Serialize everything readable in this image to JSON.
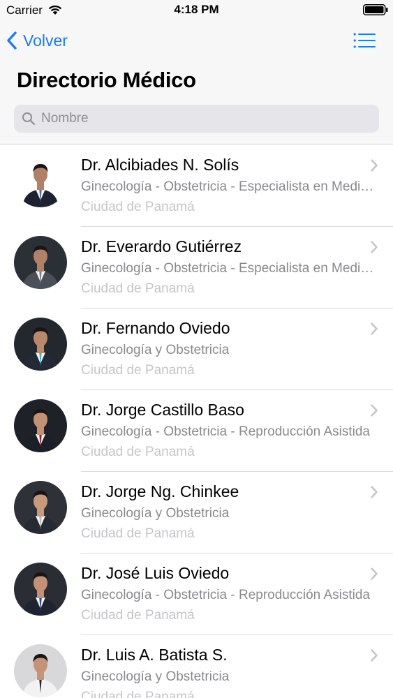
{
  "status_bar": {
    "carrier": "Carrier",
    "time": "4:18 PM",
    "icons": [
      "wifi-icon",
      "battery-icon"
    ]
  },
  "nav": {
    "back_label": "Volver",
    "back_icon": "chevron-left-icon",
    "menu_icon": "list-icon",
    "accent_color": "#1a7cf6"
  },
  "page": {
    "title": "Directorio Médico"
  },
  "search": {
    "placeholder": "Nombre",
    "value": "",
    "icon": "search-icon"
  },
  "doctors": [
    {
      "name": "Dr. Alcibiades N. Solís",
      "specialty": "Ginecología - Obstetricia - Especialista en Medicina Materno Fetal",
      "city": "Ciudad de Panamá",
      "photo_bg": "#ffffff",
      "suit": "#1d2230",
      "tie": "#5a6c94",
      "skin": "#b08068"
    },
    {
      "name": "Dr. Everardo Gutiérrez",
      "specialty": "Ginecología - Obstetricia - Especialista en Medicina Materno Fetal",
      "city": "Ciudad de Panamá",
      "photo_bg": "#2b2f36",
      "suit": "#4b5058",
      "tie": "#7a8090",
      "skin": "#b08068"
    },
    {
      "name": "Dr. Fernando Oviedo",
      "specialty": "Ginecología y Obstetricia",
      "city": "Ciudad de Panamá",
      "photo_bg": "#23272e",
      "suit": "#232a36",
      "tie": "#3cb8c0",
      "skin": "#b9896e"
    },
    {
      "name": "Dr. Jorge Castillo Baso",
      "specialty": "Ginecología - Obstetricia - Reproducción Asistida",
      "city": "Ciudad de Panamá",
      "photo_bg": "#1e2128",
      "suit": "#1b1f28",
      "tie": "#8b2030",
      "skin": "#c39276"
    },
    {
      "name": "Dr. Jorge Ng. Chinkee",
      "specialty": "Ginecología y Obstetricia",
      "city": "Ciudad de Panamá",
      "photo_bg": "#2e3138",
      "suit": "#252a33",
      "tie": "#b9b9c0",
      "skin": "#c89a7c"
    },
    {
      "name": "Dr. José Luis Oviedo",
      "specialty": "Ginecología - Obstetricia - Reproducción Asistida",
      "city": "Ciudad de Panamá",
      "photo_bg": "#2a2d33",
      "suit": "#1f2430",
      "tie": "#2c4a8a",
      "skin": "#c39276"
    },
    {
      "name": "Dr. Luis A. Batista S.",
      "specialty": "Ginecología y Obstetricia",
      "city": "Ciudad de Panamá",
      "photo_bg": "#d8d8da",
      "suit": "#f2f2f2",
      "tie": "#2b2b30",
      "skin": "#c59478"
    }
  ],
  "row_chevron_icon": "chevron-right-icon"
}
